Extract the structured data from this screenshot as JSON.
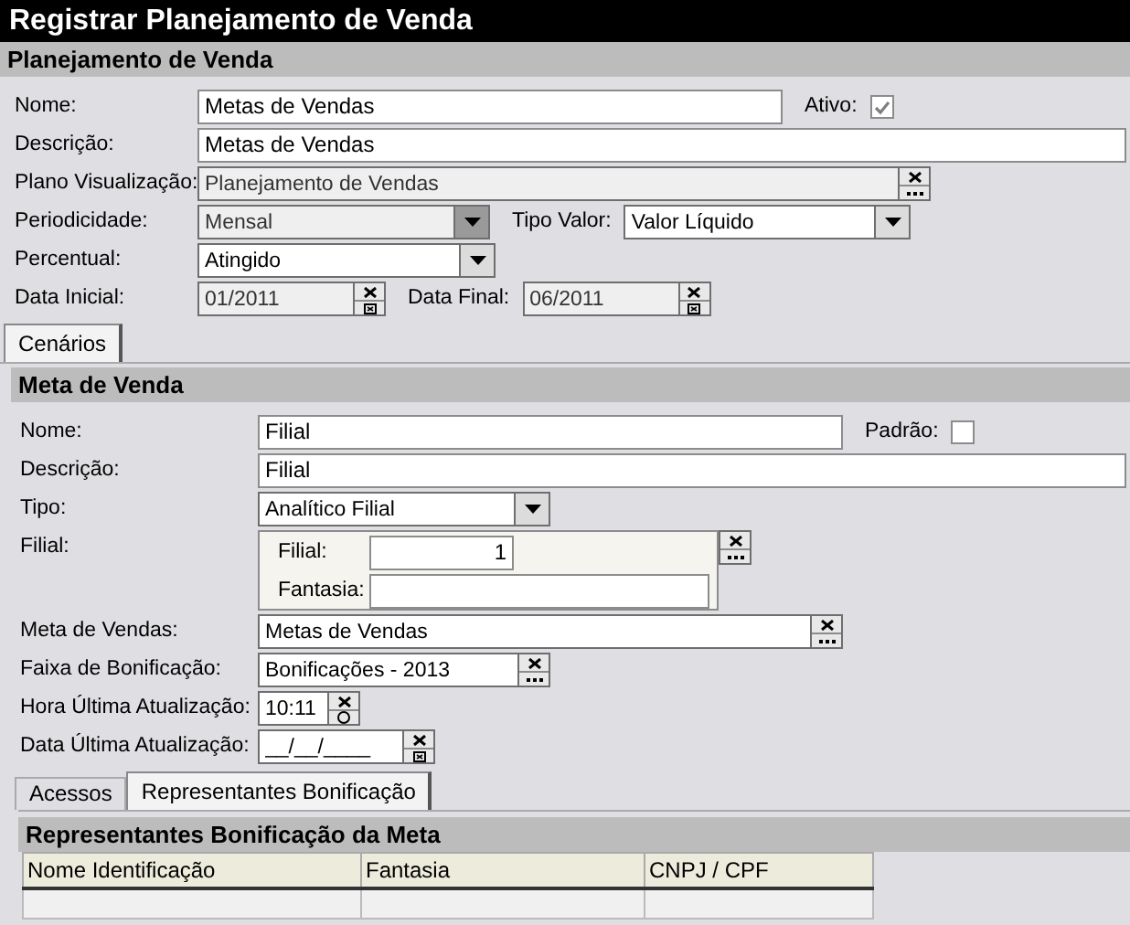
{
  "window": {
    "title": "Registrar Planejamento de Venda"
  },
  "plan": {
    "header": "Planejamento de Venda",
    "rows": [
      [
        {
          "kind": "text",
          "label": "Nome:",
          "value": "Metas de Vendas",
          "disabled": false
        },
        {
          "kind": "checkbox",
          "label": "Ativo:",
          "checked": true
        }
      ],
      [
        {
          "kind": "text",
          "label": "Descrição:",
          "value": "Metas de Vendas",
          "disabled": false
        }
      ],
      [
        {
          "kind": "lookup",
          "label": "Plano Visualização:",
          "value": "Planejamento de Vendas",
          "disabled": true
        }
      ],
      [
        {
          "kind": "combo",
          "label": "Periodicidade:",
          "value": "Mensal",
          "disabled": true
        },
        {
          "kind": "combo",
          "label": "Tipo Valor:",
          "value": "Valor Líquido",
          "disabled": false
        }
      ],
      [
        {
          "kind": "combo",
          "label": "Percentual:",
          "value": "Atingido",
          "disabled": false
        }
      ],
      [
        {
          "kind": "date",
          "label": "Data Inicial:",
          "value": "01/2011",
          "disabled": true
        },
        {
          "kind": "date",
          "label": "Data Final:",
          "value": "06/2011",
          "disabled": true
        }
      ]
    ]
  },
  "tabs": [
    {
      "label": "Cenários",
      "selected": true
    }
  ],
  "meta": {
    "header": "Meta de Venda",
    "rows": [
      [
        {
          "kind": "text",
          "label": "Nome:",
          "value": "Filial",
          "disabled": false
        },
        {
          "kind": "checkbox",
          "label": "Padrão:",
          "checked": false
        }
      ],
      [
        {
          "kind": "text",
          "label": "Descrição:",
          "value": "Filial",
          "disabled": false
        }
      ],
      [
        {
          "kind": "combo",
          "label": "Tipo:",
          "value": "Analítico Filial",
          "disabled": false
        }
      ],
      [
        {
          "kind": "group",
          "label": "Filial:",
          "fields": [
            {
              "label": "Filial:",
              "value": "1"
            },
            {
              "label": "Fantasia:"
            }
          ]
        }
      ],
      [
        {
          "kind": "lookup",
          "label": "Meta de Vendas:",
          "value": "Metas de Vendas",
          "disabled": false
        }
      ],
      [
        {
          "kind": "lookup",
          "label": "Faixa de Bonificação:",
          "value": "Bonificações - 2013",
          "disabled": false
        }
      ],
      [
        {
          "kind": "time",
          "label": "Hora Última Atualização:",
          "value": "10:11",
          "disabled": false
        }
      ],
      [
        {
          "kind": "date",
          "label": "Data Última Atualização:",
          "value": "__/__/____",
          "disabled": false
        }
      ]
    ]
  },
  "inner_tabs": [
    {
      "label": "Acessos",
      "selected": false
    },
    {
      "label": "Representantes Bonificação",
      "selected": true
    }
  ],
  "grid": {
    "header": "Representantes Bonificação da Meta",
    "columns": [
      "Nome Identificação",
      "Fantasia",
      "CNPJ / CPF"
    ]
  }
}
